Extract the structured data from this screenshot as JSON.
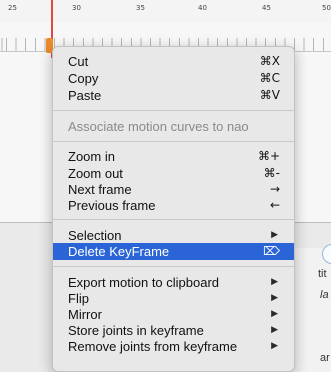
{
  "ruler": {
    "labels": [
      "25",
      "30",
      "35",
      "40",
      "45",
      "50"
    ]
  },
  "background": {
    "peek_text_1": "tit",
    "peek_text_2": "la",
    "peek_text_3": "ar"
  },
  "menu": {
    "cut": {
      "label": "Cut",
      "shortcut": "⌘X"
    },
    "copy": {
      "label": "Copy",
      "shortcut": "⌘C"
    },
    "paste": {
      "label": "Paste",
      "shortcut": "⌘V"
    },
    "associate": {
      "label": "Associate motion curves to nao"
    },
    "zoom_in": {
      "label": "Zoom in",
      "shortcut": "⌘+"
    },
    "zoom_out": {
      "label": "Zoom out",
      "shortcut": "⌘-"
    },
    "next_frame": {
      "label": "Next frame",
      "shortcut": "→"
    },
    "previous_frame": {
      "label": "Previous frame",
      "shortcut": "←"
    },
    "selection": {
      "label": "Selection",
      "icon": "submenu-arrow-icon"
    },
    "delete_keyframe": {
      "label": "Delete KeyFrame",
      "shortcut": "⌦"
    },
    "export_motion": {
      "label": "Export motion to clipboard",
      "icon": "submenu-arrow-icon"
    },
    "flip": {
      "label": "Flip",
      "icon": "submenu-arrow-icon"
    },
    "mirror": {
      "label": "Mirror",
      "icon": "submenu-arrow-icon"
    },
    "store_joints": {
      "label": "Store joints in keyframe",
      "icon": "submenu-arrow-icon"
    },
    "remove_joints": {
      "label": "Remove joints from keyframe",
      "icon": "submenu-arrow-icon"
    }
  },
  "colors": {
    "highlight": "#2a64d6",
    "keyframe": "#ef8a2c",
    "playhead": "#e94444"
  }
}
